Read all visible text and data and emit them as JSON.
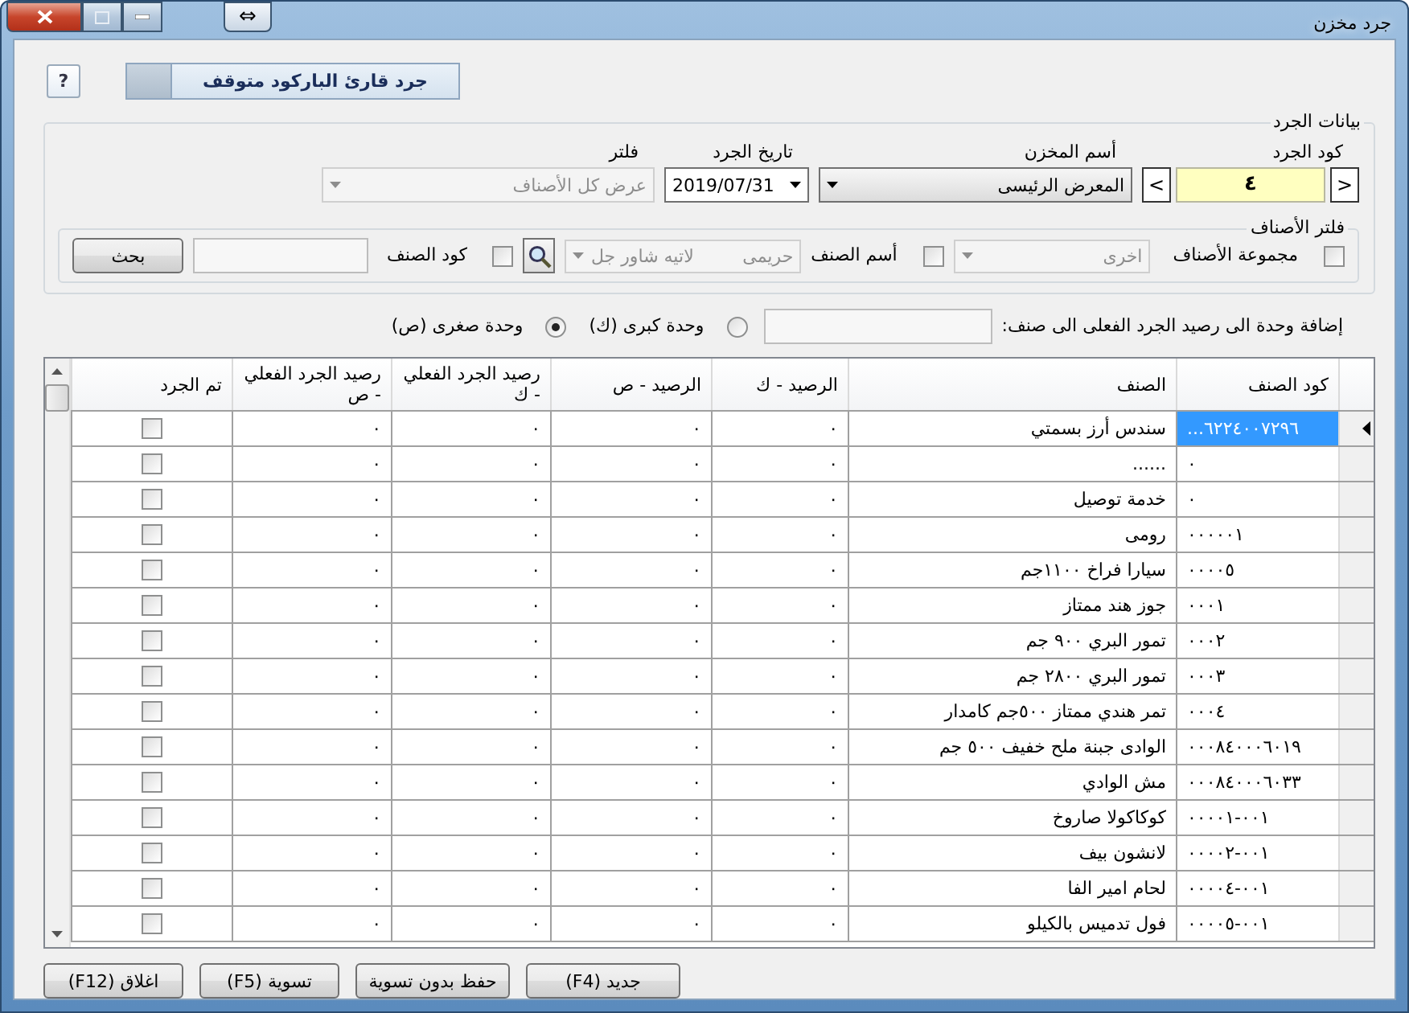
{
  "window": {
    "title": "جرد مخزن",
    "move_glyph": "⇔"
  },
  "toolbar": {
    "help_label": "?",
    "barcode_status": "جرد قارئ الباركود متوقف",
    "barcode_on": false
  },
  "count_data": {
    "title": "بيانات الجرد",
    "code": {
      "label": "كود الجرد",
      "value": "٤",
      "prev": "<",
      "next": ">"
    },
    "store": {
      "label": "أسم المخزن",
      "value": "المعرض الرئيسى"
    },
    "date": {
      "label": "تاريخ الجرد",
      "value": "2019/07/31"
    },
    "filter": {
      "label": "فلتر",
      "value": "عرض كل الأصناف",
      "disabled": true
    }
  },
  "item_filter": {
    "title": "فلتر الأصناف",
    "group": {
      "label": "مجموعة الأصناف",
      "checked": false,
      "value": "اخرى",
      "disabled": true
    },
    "name": {
      "label": "أسم الصنف",
      "checked": false,
      "values": [
        "حريمى",
        "لاتيه شاور جل"
      ],
      "disabled": true
    },
    "code": {
      "label": "كود الصنف",
      "checked": false
    },
    "search_button": "بحث"
  },
  "unit_add": {
    "label": "إضافة وحدة الى رصيد الجرد الفعلى الى صنف:",
    "options": [
      {
        "label": "وحدة كبرى (ك)",
        "selected": false
      },
      {
        "label": "وحدة صغرى (ص)",
        "selected": true
      }
    ]
  },
  "table": {
    "columns": [
      "كود الصنف",
      "الصنف",
      "الرصيد - ك",
      "الرصيد - ص",
      "رصيد الجرد الفعلي - ك",
      "رصيد الجرد الفعلي - ص",
      "تم الجرد"
    ],
    "rows": [
      {
        "code": "...٦٢٢٤٠٠٧٢٩٦",
        "name": "سندس أرز بسمتي",
        "balance_k": "٠",
        "balance_s": "٠",
        "actual_k": "٠",
        "actual_s": "٠",
        "done": false,
        "selected": true
      },
      {
        "code": "٠",
        "name": "......",
        "balance_k": "٠",
        "balance_s": "٠",
        "actual_k": "٠",
        "actual_s": "٠",
        "done": false,
        "selected": false
      },
      {
        "code": "٠",
        "name": "خدمة توصيل",
        "balance_k": "٠",
        "balance_s": "٠",
        "actual_k": "٠",
        "actual_s": "٠",
        "done": false,
        "selected": false
      },
      {
        "code": "٠٠٠٠٠١",
        "name": "رومى",
        "balance_k": "٠",
        "balance_s": "٠",
        "actual_k": "٠",
        "actual_s": "٠",
        "done": false,
        "selected": false
      },
      {
        "code": "٠٠٠٠٥",
        "name": "سيارا  فراخ ١١٠٠جم",
        "balance_k": "٠",
        "balance_s": "٠",
        "actual_k": "٠",
        "actual_s": "٠",
        "done": false,
        "selected": false
      },
      {
        "code": "٠٠٠١",
        "name": "جوز هند ممتاز",
        "balance_k": "٠",
        "balance_s": "٠",
        "actual_k": "٠",
        "actual_s": "٠",
        "done": false,
        "selected": false
      },
      {
        "code": "٠٠٠٢",
        "name": "تمور البري ٩٠٠ جم",
        "balance_k": "٠",
        "balance_s": "٠",
        "actual_k": "٠",
        "actual_s": "٠",
        "done": false,
        "selected": false
      },
      {
        "code": "٠٠٠٣",
        "name": "تمور البري ٢٨٠٠ جم",
        "balance_k": "٠",
        "balance_s": "٠",
        "actual_k": "٠",
        "actual_s": "٠",
        "done": false,
        "selected": false
      },
      {
        "code": "٠٠٠٤",
        "name": "تمر هندي ممتاز ٥٠٠جم كامدار",
        "balance_k": "٠",
        "balance_s": "٠",
        "actual_k": "٠",
        "actual_s": "٠",
        "done": false,
        "selected": false
      },
      {
        "code": "٠٠٠٨٤٠٠٠٦٠١٩",
        "name": "الوادى جبنة ملح خفيف ٥٠٠ جم",
        "balance_k": "٠",
        "balance_s": "٠",
        "actual_k": "٠",
        "actual_s": "٠",
        "done": false,
        "selected": false
      },
      {
        "code": "٠٠٠٨٤٠٠٠٦٠٣٣",
        "name": "مش الوادي",
        "balance_k": "٠",
        "balance_s": "٠",
        "actual_k": "٠",
        "actual_s": "٠",
        "done": false,
        "selected": false
      },
      {
        "code": "٠٠١-٠٠٠٠١",
        "name": "كوكاكولا صاروخ",
        "balance_k": "٠",
        "balance_s": "٠",
        "actual_k": "٠",
        "actual_s": "٠",
        "done": false,
        "selected": false
      },
      {
        "code": "٠٠١-٠٠٠٠٢",
        "name": "لانشون بيف",
        "balance_k": "٠",
        "balance_s": "٠",
        "actual_k": "٠",
        "actual_s": "٠",
        "done": false,
        "selected": false
      },
      {
        "code": "٠٠١-٠٠٠٠٤",
        "name": "لحام امير الفا",
        "balance_k": "٠",
        "balance_s": "٠",
        "actual_k": "٠",
        "actual_s": "٠",
        "done": false,
        "selected": false
      },
      {
        "code": "٠٠١-٠٠٠٠٥",
        "name": "فول تدميس بالكيلو",
        "balance_k": "٠",
        "balance_s": "٠",
        "actual_k": "٠",
        "actual_s": "٠",
        "done": false,
        "selected": false
      }
    ]
  },
  "buttons": [
    "جديد (F4)",
    "حفظ بدون تسوية",
    "تسوية (F5)",
    "اغلاق (F12)"
  ]
}
